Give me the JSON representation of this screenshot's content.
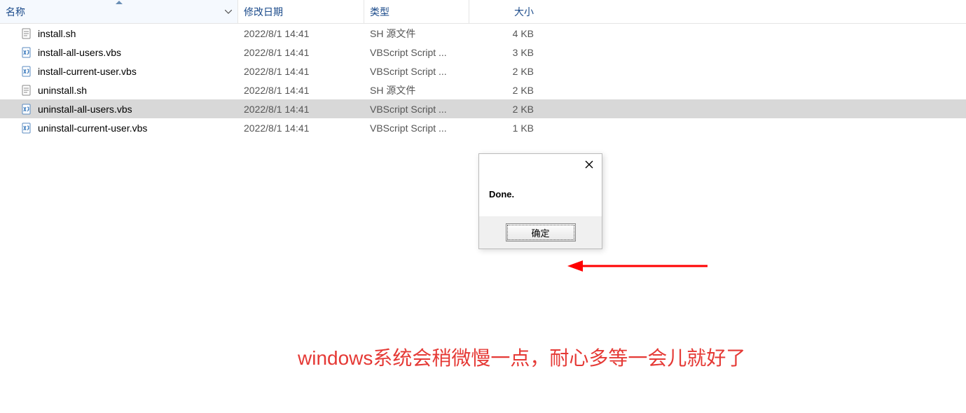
{
  "columns": {
    "name": "名称",
    "date": "修改日期",
    "type": "类型",
    "size": "大小"
  },
  "files": [
    {
      "icon": "sh",
      "name": "install.sh",
      "date": "2022/8/1 14:41",
      "type": "SH 源文件",
      "size": "4 KB",
      "selected": false
    },
    {
      "icon": "vbs",
      "name": "install-all-users.vbs",
      "date": "2022/8/1 14:41",
      "type": "VBScript Script ...",
      "size": "3 KB",
      "selected": false
    },
    {
      "icon": "vbs",
      "name": "install-current-user.vbs",
      "date": "2022/8/1 14:41",
      "type": "VBScript Script ...",
      "size": "2 KB",
      "selected": false
    },
    {
      "icon": "sh",
      "name": "uninstall.sh",
      "date": "2022/8/1 14:41",
      "type": "SH 源文件",
      "size": "2 KB",
      "selected": false
    },
    {
      "icon": "vbs",
      "name": "uninstall-all-users.vbs",
      "date": "2022/8/1 14:41",
      "type": "VBScript Script ...",
      "size": "2 KB",
      "selected": true
    },
    {
      "icon": "vbs",
      "name": "uninstall-current-user.vbs",
      "date": "2022/8/1 14:41",
      "type": "VBScript Script ...",
      "size": "1 KB",
      "selected": false
    }
  ],
  "dialog": {
    "message": "Done.",
    "ok_label": "确定"
  },
  "caption": "windows系统会稍微慢一点，耐心多等一会儿就好了"
}
